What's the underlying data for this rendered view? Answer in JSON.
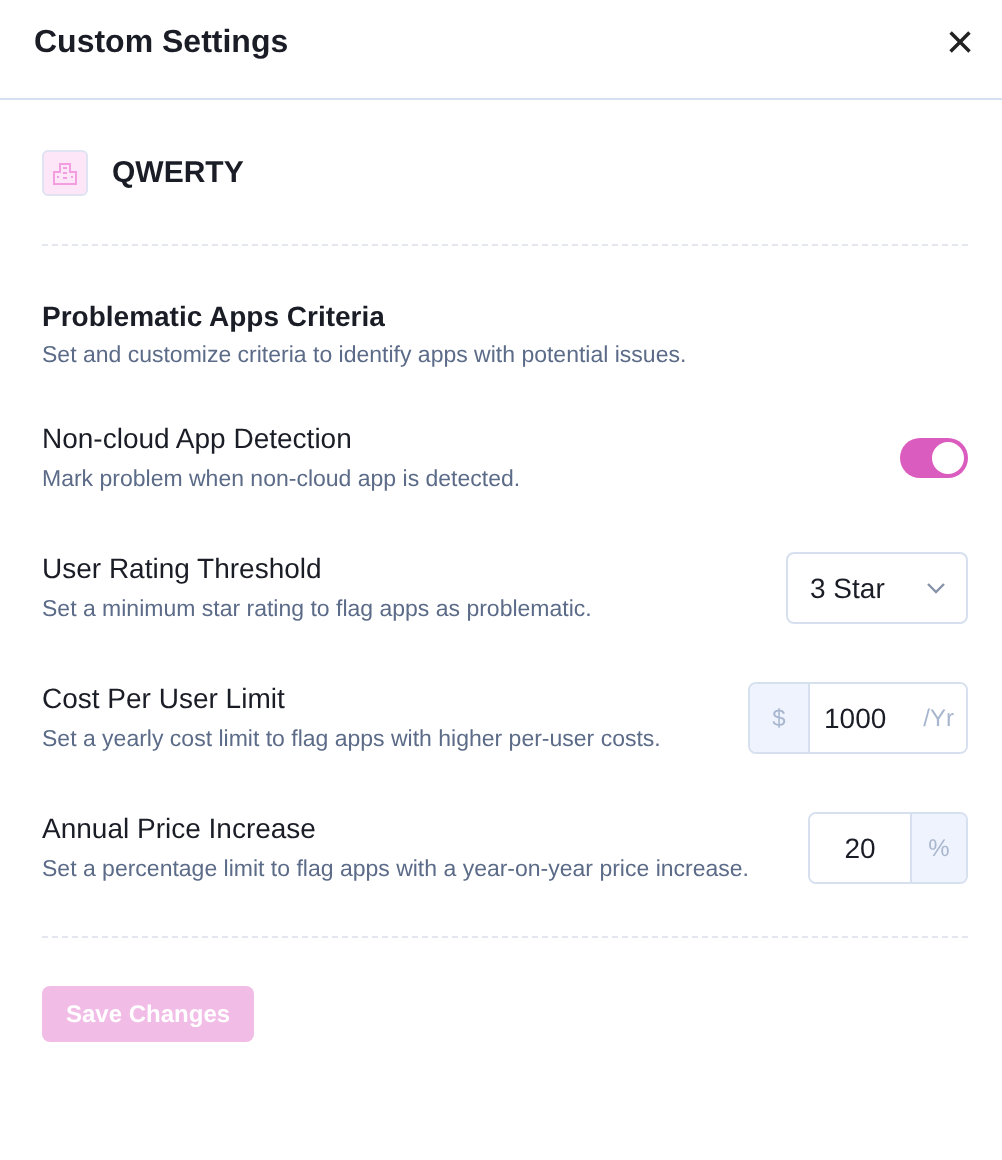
{
  "dialog": {
    "title": "Custom Settings",
    "close": "×"
  },
  "app": {
    "name": "QWERTY"
  },
  "section": {
    "title": "Problematic Apps Criteria",
    "description": "Set and customize criteria to identify apps with potential issues."
  },
  "settings": [
    {
      "kind": "toggle",
      "label": "Non-cloud App Detection",
      "description": "Mark problem when non-cloud app is detected.",
      "on": true
    },
    {
      "kind": "select",
      "label": "User Rating Threshold",
      "description": "Set a minimum star rating to flag apps as problematic.",
      "value": "3 Star"
    },
    {
      "kind": "prefix-input",
      "label": "Cost Per User Limit",
      "description": "Set a yearly cost limit to flag apps with higher per-user costs.",
      "prefix": "$",
      "value": "1000",
      "unit": "/Yr"
    },
    {
      "kind": "suffix-input",
      "label": "Annual Price Increase",
      "description": "Set a percentage limit to flag apps with a year-on-year price increase.",
      "value": "20",
      "suffix": "%"
    }
  ],
  "save_button": {
    "label": "Save Changes",
    "disabled": true
  }
}
